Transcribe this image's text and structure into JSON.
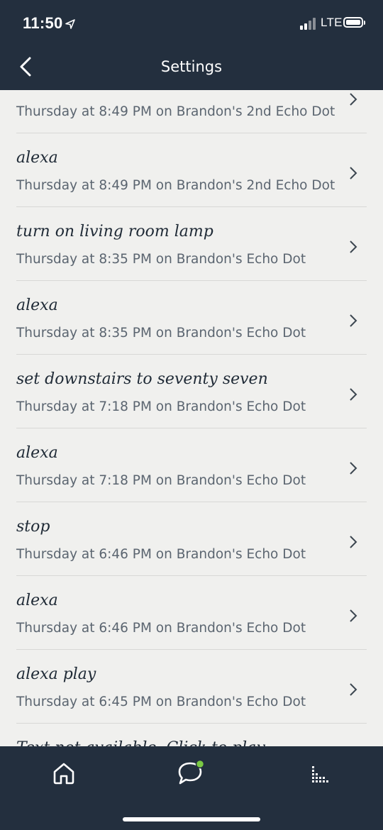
{
  "status_bar": {
    "time": "11:50",
    "network": "LTE"
  },
  "header": {
    "title": "Settings"
  },
  "history": [
    {
      "utterance": "",
      "meta": "Thursday at 8:49 PM on Brandon's 2nd Echo Dot"
    },
    {
      "utterance": "alexa",
      "meta": "Thursday at 8:49 PM on Brandon's 2nd Echo Dot"
    },
    {
      "utterance": "turn on living room lamp",
      "meta": "Thursday at 8:35 PM on Brandon's Echo Dot"
    },
    {
      "utterance": "alexa",
      "meta": "Thursday at 8:35 PM on Brandon's Echo Dot"
    },
    {
      "utterance": "set downstairs to seventy seven",
      "meta": "Thursday at 7:18 PM on Brandon's Echo Dot"
    },
    {
      "utterance": "alexa",
      "meta": "Thursday at 7:18 PM on Brandon's Echo Dot"
    },
    {
      "utterance": "stop",
      "meta": "Thursday at 6:46 PM on Brandon's Echo Dot"
    },
    {
      "utterance": "alexa",
      "meta": "Thursday at 6:46 PM on Brandon's Echo Dot"
    },
    {
      "utterance": "alexa play",
      "meta": "Thursday at 6:45 PM on Brandon's Echo Dot"
    },
    {
      "utterance": "Text not available. Click to play",
      "meta": ""
    }
  ],
  "tabs": [
    {
      "icon": "home-icon"
    },
    {
      "icon": "communicate-icon"
    },
    {
      "icon": "activity-icon"
    }
  ],
  "colors": {
    "header_bg": "#232f3e",
    "list_bg": "#f0f0ee",
    "badge_green": "#7ac943"
  }
}
